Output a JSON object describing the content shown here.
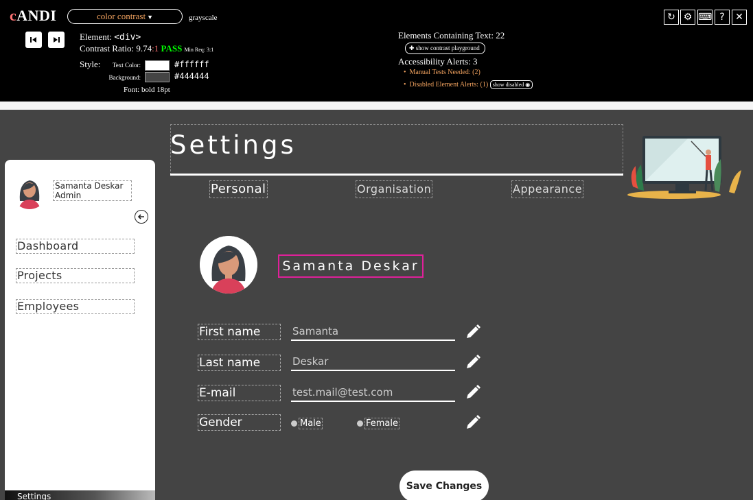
{
  "andi": {
    "logo_c": "c",
    "logo_rest": "ANDI",
    "mode": "color contrast",
    "grayscale_label": "grayscale",
    "element_label": "Element:",
    "element_value": "<div>",
    "ratio_label": "Contrast Ratio:",
    "ratio_value": "9.74",
    "ratio_suffix": ":1",
    "result": "PASS",
    "min_req": "Min Req: 3:1",
    "style_label": "Style:",
    "text_color_label": "Text Color:",
    "text_color_value": "#ffffff",
    "background_label": "Background:",
    "background_value": "#444444",
    "font_label": "Font:",
    "font_value": "bold 18pt",
    "elements_text": "Elements Containing Text: 22",
    "playground_button": "show contrast playground",
    "alerts_title": "Accessibility Alerts: 3",
    "alerts": [
      "Manual Tests Needed: (2)",
      "Disabled Element Alerts: (1)"
    ],
    "show_disabled": "show disabled",
    "controls": [
      "refresh-icon",
      "settings-icon",
      "keyboard-icon",
      "help-icon",
      "close-icon"
    ],
    "help_label": "?",
    "close_label": "✕"
  },
  "colors": {
    "page_bg": "#444444",
    "accent_pink": "#e0209a",
    "andi_orange": "#f4a460",
    "pass_green": "#00ff00"
  },
  "sidebar": {
    "user_name": "Samanta Deskar",
    "user_role": "Admin",
    "items": [
      {
        "label": "Dashboard"
      },
      {
        "label": "Projects"
      },
      {
        "label": "Employees"
      }
    ],
    "bottom_item": "Settings"
  },
  "main": {
    "title": "Settings",
    "tabs": [
      {
        "label": "Personal",
        "active": true
      },
      {
        "label": "Organisation",
        "active": false
      },
      {
        "label": "Appearance",
        "active": false
      }
    ],
    "profile_name": "Samanta Deskar",
    "fields": [
      {
        "label": "First name",
        "value": "Samanta"
      },
      {
        "label": "Last name",
        "value": "Deskar"
      },
      {
        "label": "E-mail",
        "value": "test.mail@test.com"
      }
    ],
    "gender": {
      "label": "Gender",
      "options": [
        "Male",
        "Female"
      ]
    },
    "save_button": "Save Changes"
  }
}
